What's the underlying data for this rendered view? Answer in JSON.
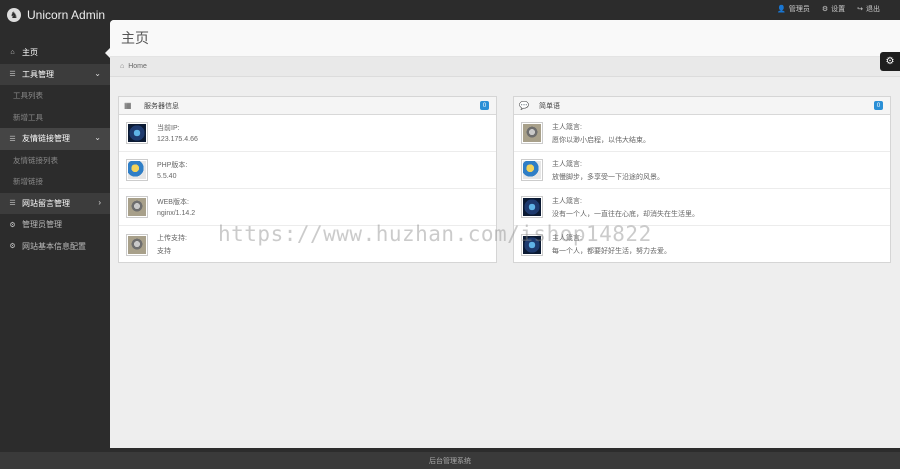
{
  "app": {
    "brand": "Unicorn Admin"
  },
  "topbar": {
    "links": [
      {
        "icon": "user-icon",
        "glyph": "👤",
        "label": "管理员"
      },
      {
        "icon": "cog-icon",
        "glyph": "⚙",
        "label": "设置"
      },
      {
        "icon": "share-icon",
        "glyph": "↪",
        "label": "退出"
      }
    ]
  },
  "sidebar": {
    "items": [
      {
        "label": "主页",
        "glyph": "⌂"
      },
      {
        "label": "工具管理",
        "glyph": "☰"
      },
      {
        "label": "工具列表"
      },
      {
        "label": "新增工具"
      },
      {
        "label": "友情链接管理",
        "glyph": "☰"
      },
      {
        "label": "友情链接列表"
      },
      {
        "label": "新增链接"
      },
      {
        "label": "网站留言管理",
        "glyph": "☰"
      },
      {
        "label": "管理员管理",
        "glyph": "⚙"
      },
      {
        "label": "网站基本信息配置",
        "glyph": "⚙"
      }
    ]
  },
  "page": {
    "title": "主页"
  },
  "breadcrumb": {
    "home": "Home"
  },
  "server_widget": {
    "title": "服务器信息",
    "badge": "0",
    "rows": [
      {
        "label": "当前IP:",
        "value": "123.175.4.66"
      },
      {
        "label": "PHP版本:",
        "value": "5.5.40"
      },
      {
        "label": "WEB版本:",
        "value": "nginx/1.14.2"
      },
      {
        "label": "上传支持:",
        "value": "支持"
      }
    ]
  },
  "quotes_widget": {
    "title": "简单语",
    "badge": "0",
    "rows": [
      {
        "label": "主人箴言:",
        "value": "愿你以渺小启程，以伟大结束。"
      },
      {
        "label": "主人箴言:",
        "value": "放慢脚步，多享受一下沿途的风景。"
      },
      {
        "label": "主人箴言:",
        "value": "没有一个人，一直往在心底，却消失在生活里。"
      },
      {
        "label": "主人箴言:",
        "value": "每一个人，都要好好生活，努力去爱。"
      }
    ]
  },
  "footer": {
    "text": "后台管理系统"
  },
  "watermark": {
    "text": "https://www.huzhan.com/ishop14822"
  },
  "colors": {
    "accent": "#2a8fd6",
    "sidebar": "#2c2c2c",
    "content_bg": "#eeeeee"
  }
}
